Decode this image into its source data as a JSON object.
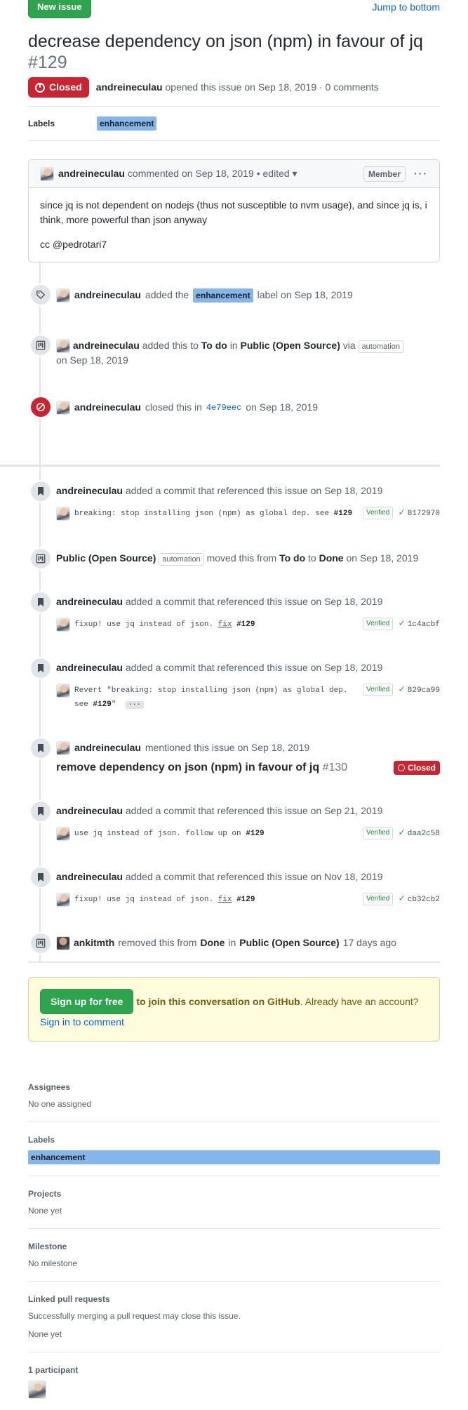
{
  "topbar": {
    "new_issue": "New issue",
    "jump": "Jump to bottom"
  },
  "issue": {
    "title": "decrease dependency on json (npm) in favour of jq",
    "number": "#129",
    "state": "Closed",
    "author": "andreineculau",
    "opened_text": "opened this issue on Sep 18, 2019 · 0 comments"
  },
  "labels_row": {
    "heading": "Labels",
    "label": "enhancement"
  },
  "comment": {
    "author": "andreineculau",
    "meta": "commented on Sep 18, 2019",
    "edited": "• edited ▾",
    "role": "Member",
    "menu": "···",
    "body1": "since jq is not dependent on nodejs (thus not susceptible to nvm usage), and since jq is, i think, more powerful than json anyway",
    "body2": "cc @pedrotari7"
  },
  "events": {
    "e1": {
      "actor": "andreineculau",
      "pre": "added the",
      "label": "enhancement",
      "post": "label on Sep 18, 2019"
    },
    "e2": {
      "actor": "andreineculau",
      "pre": "added this to",
      "col": "To do",
      "in": "in",
      "project": "Public (Open Source)",
      "via": "via",
      "automation": "automation",
      "date": "on Sep 18, 2019"
    },
    "e3": {
      "actor": "andreineculau",
      "pre": "closed this in",
      "sha": "4e79eec",
      "date": "on Sep 18, 2019"
    },
    "c1": {
      "actor": "andreineculau",
      "text": "added a commit that referenced this issue on Sep 18, 2019",
      "msg": "breaking: stop installing json (npm) as global dep. see",
      "ref": "#129",
      "verified": "Verified",
      "sha": "8172970"
    },
    "m1": {
      "project": "Public (Open Source)",
      "automation": "automation",
      "pre": "moved this from",
      "from": "To do",
      "to_word": "to",
      "to": "Done",
      "date": "on Sep 18, 2019"
    },
    "c2": {
      "actor": "andreineculau",
      "text": "added a commit that referenced this issue on Sep 18, 2019",
      "msg": "fixup! use jq instead of json.",
      "fix": "fix",
      "ref": "#129",
      "verified": "Verified",
      "sha": "1c4acbf"
    },
    "c3": {
      "actor": "andreineculau",
      "text": "added a commit that referenced this issue on Sep 18, 2019",
      "msg1": "Revert \"breaking: stop installing json (npm) as global dep.",
      "msg2": "see",
      "ref": "#129",
      "quote": "\"",
      "ellipsis": "···",
      "verified": "Verified",
      "sha": "829ca99"
    },
    "mention": {
      "actor": "andreineculau",
      "text": "mentioned this issue on Sep 18, 2019",
      "ref_title": "remove dependency on json (npm) in favour of jq",
      "ref_num": "#130",
      "state": "Closed"
    },
    "c4": {
      "actor": "andreineculau",
      "text": "added a commit that referenced this issue on Sep 21, 2019",
      "msg": "use jq instead of json. follow up on",
      "ref": "#129",
      "verified": "Verified",
      "sha": "daa2c58"
    },
    "c5": {
      "actor": "andreineculau",
      "text": "added a commit that referenced this issue on Nov 18, 2019",
      "msg": "fixup! use jq instead of json.",
      "fix": "fix",
      "ref": "#129",
      "verified": "Verified",
      "sha": "cb32cb2"
    },
    "r1": {
      "actor": "ankitmth",
      "pre": "removed this from",
      "col": "Done",
      "in": "in",
      "project": "Public (Open Source)",
      "date": "17 days ago"
    }
  },
  "signup": {
    "button": "Sign up for free",
    "text": "to join this conversation on GitHub",
    "dot": ". Already have an account?",
    "link": "Sign in to comment"
  },
  "sidebar": {
    "assignees": {
      "h": "Assignees",
      "v": "No one assigned"
    },
    "labels": {
      "h": "Labels",
      "v": "enhancement"
    },
    "projects": {
      "h": "Projects",
      "v": "None yet"
    },
    "milestone": {
      "h": "Milestone",
      "v": "No milestone"
    },
    "linked": {
      "h": "Linked pull requests",
      "desc": "Successfully merging a pull request may close this issue.",
      "v": "None yet"
    },
    "participants": {
      "h": "1 participant"
    }
  },
  "colors": {
    "closed": "#cb2431",
    "green": "#2ea44f",
    "label": "#84b6eb",
    "link": "#0366d6"
  }
}
